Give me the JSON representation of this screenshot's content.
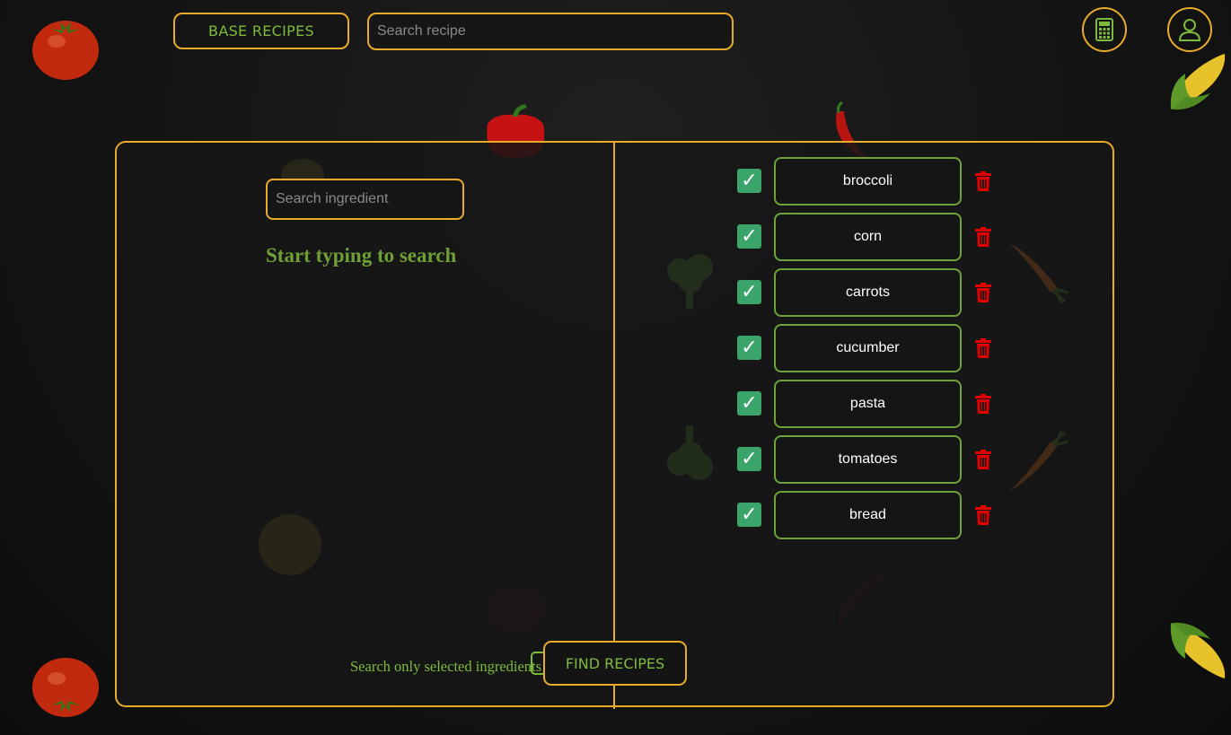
{
  "header": {
    "base_recipes_label": "BASE RECIPES",
    "search_recipe_placeholder": "Search recipe",
    "calculator_icon": "calculator-icon",
    "user_icon": "user-icon"
  },
  "left": {
    "search_ingredient_placeholder": "Search ingredient",
    "hint": "Start typing to search",
    "only_selected_label": "Search only selected ingredients"
  },
  "find_recipes_label": "FIND RECIPES",
  "ingredients": [
    {
      "name": "broccoli",
      "checked": true
    },
    {
      "name": "corn",
      "checked": true
    },
    {
      "name": "carrots",
      "checked": true
    },
    {
      "name": "cucumber",
      "checked": true
    },
    {
      "name": "pasta",
      "checked": true
    },
    {
      "name": "tomatoes",
      "checked": true
    },
    {
      "name": "bread",
      "checked": true
    }
  ],
  "colors": {
    "accent": "#e8ab2a",
    "green": "#7dbb3c",
    "check": "#3aa46b",
    "delete": "#e00000"
  }
}
